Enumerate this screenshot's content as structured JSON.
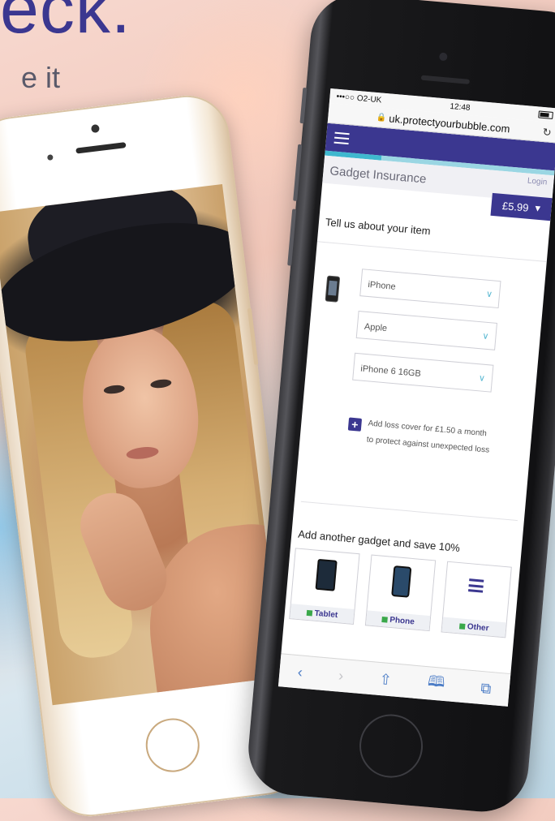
{
  "headline": "eck.",
  "subline": "e it",
  "status_bar": {
    "carrier": "•••○○ O2-UK",
    "wifi_icon": "wifi-icon",
    "time": "12:48",
    "battery_icon": "battery-icon"
  },
  "browser": {
    "url": "uk.protectyourbubble.com",
    "lock_icon": "lock-icon",
    "reload_icon": "reload-icon"
  },
  "site": {
    "menu_icon": "hamburger-icon",
    "title": "Gadget Insurance",
    "login_label": "Login",
    "price": "£5.99",
    "price_caret": "▾"
  },
  "form": {
    "section_title": "Tell us about your item",
    "fields": [
      {
        "value": "iPhone",
        "chevron": "∨"
      },
      {
        "value": "Apple",
        "chevron": "∨"
      },
      {
        "value": "iPhone 6 16GB",
        "chevron": "∨"
      }
    ],
    "addon_text": "Add loss cover for £1.50 a month to protect against unexpected loss"
  },
  "gadgets": {
    "title": "Add another gadget and save 10%",
    "items": [
      {
        "label": "Tablet",
        "icon": "tablet-icon"
      },
      {
        "label": "Phone",
        "icon": "phone-icon"
      },
      {
        "label": "Other",
        "icon": "menu-icon"
      }
    ]
  },
  "safari_toolbar": {
    "back": "‹",
    "forward": "›",
    "share": "⇧",
    "bookmarks": "🕮",
    "tabs": "⧉"
  },
  "colors": {
    "brand": "#3b3790",
    "accent": "#3fb8cf",
    "gadget_badge": "#3aa84a"
  }
}
